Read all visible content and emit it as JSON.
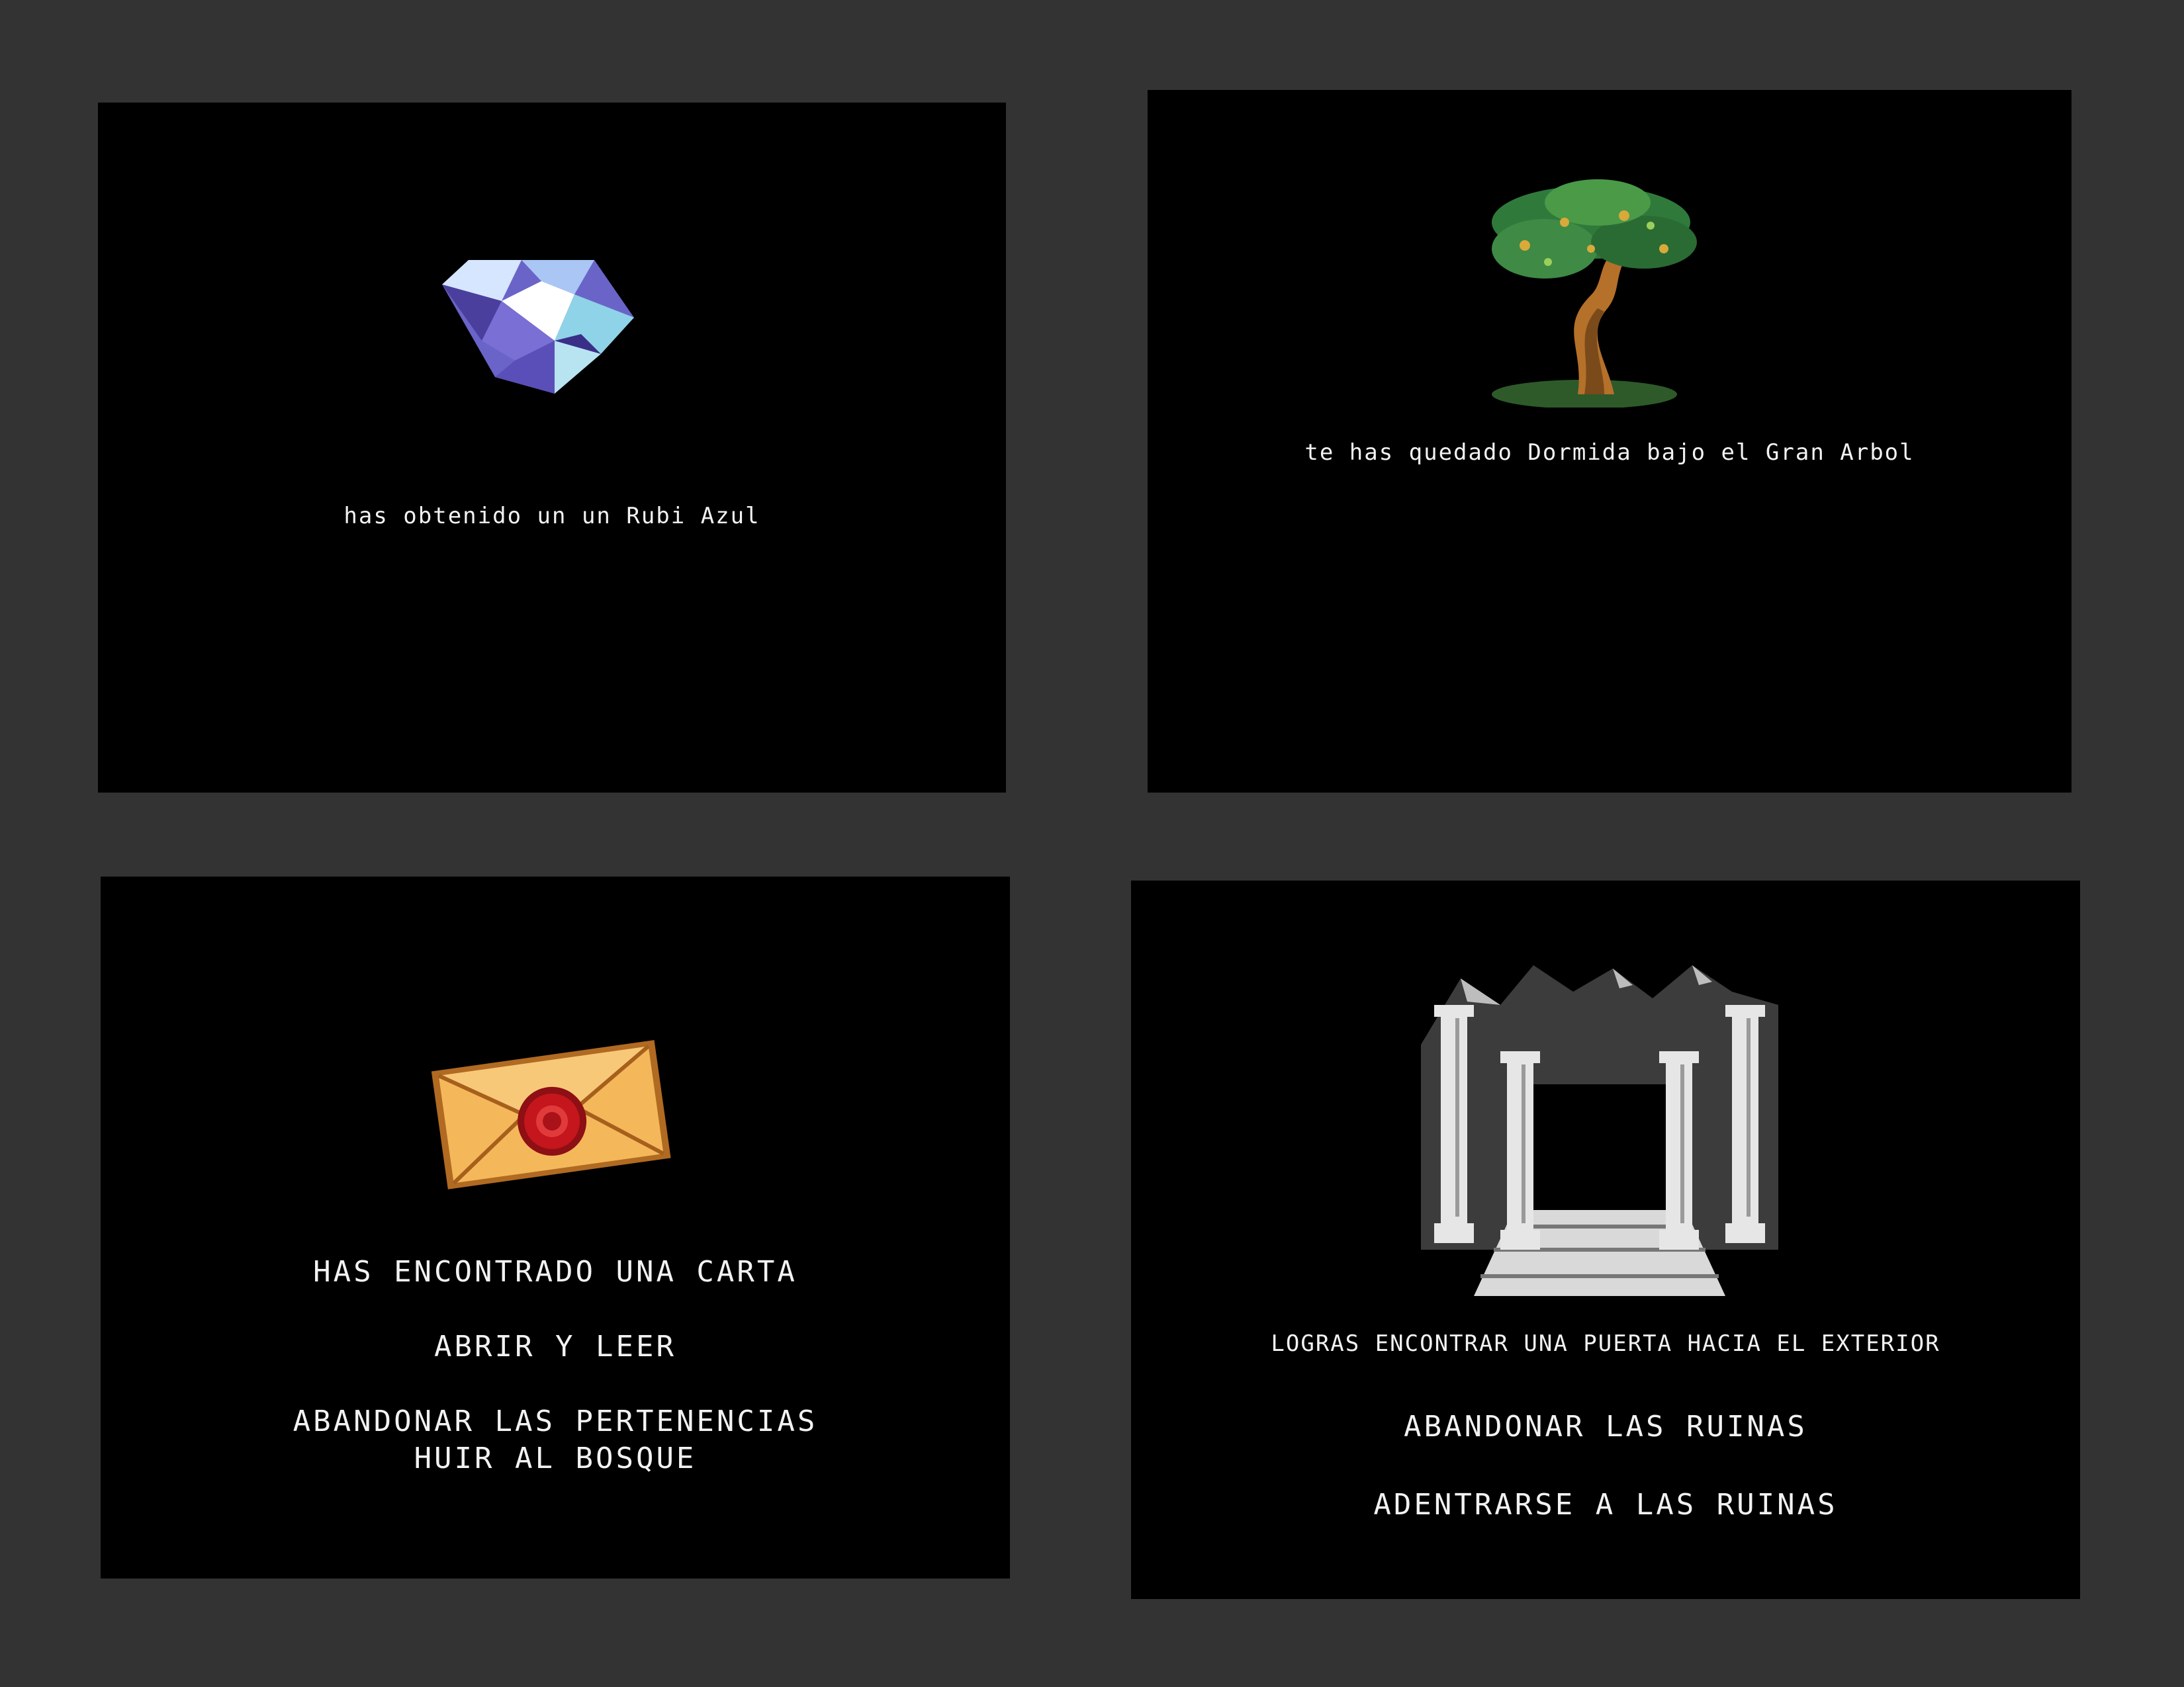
{
  "scenes": [
    {
      "image": "blue-ruby-icon",
      "message": "has obtenido un un Rubi Azul"
    },
    {
      "image": "great-tree-icon",
      "message": "te has quedado Dormida bajo el Gran Arbol"
    },
    {
      "image": "sealed-letter-icon",
      "message": "HAS ENCONTRADO UNA CARTA",
      "options": [
        "ABRIR Y LEER",
        "ABANDONAR LAS PERTENENCIAS",
        "HUIR AL BOSQUE"
      ]
    },
    {
      "image": "ruins-gate-icon",
      "message": "LOGRAS ENCONTRAR UNA PUERTA HACIA EL EXTERIOR",
      "options": [
        "ABANDONAR LAS RUINAS",
        "ADENTRARSE A LAS RUINAS"
      ]
    }
  ],
  "colors": {
    "background": "#333333",
    "panel": "#000000",
    "text": "#f2f2f2",
    "ruby": "#8f86e0",
    "leaf": "#2f7a3b",
    "trunk": "#b5702a",
    "envelope": "#f4b85a",
    "seal": "#c4161c",
    "stone": "#d9d9d9"
  }
}
